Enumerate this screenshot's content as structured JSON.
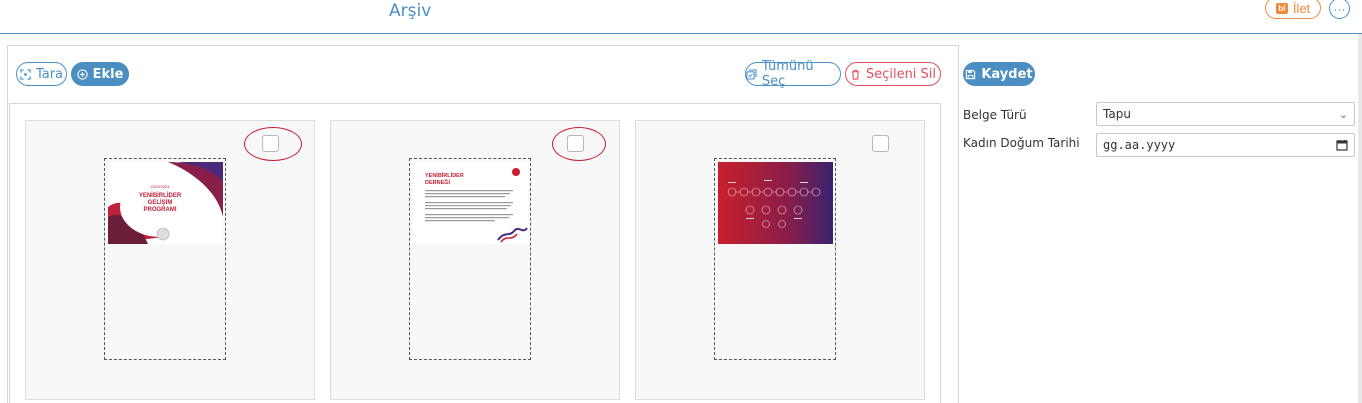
{
  "header": {
    "title": "Arşiv",
    "ilet_label": "İlet",
    "more_label": "···"
  },
  "toolbar": {
    "tara_label": "Tara",
    "ekle_label": "Ekle",
    "select_all_label": "Tümünü Seç",
    "delete_selected_label": "Seçileni Sil"
  },
  "documents": [
    {
      "id": "1",
      "checked": false,
      "highlighted": true,
      "thumb_lines": [
        "2023/2024",
        "YENİBİRLİDER",
        "GELİŞİM",
        "PROGRAMI"
      ]
    },
    {
      "id": "2",
      "checked": false,
      "highlighted": true,
      "thumb_lines": [
        "YENİBİRLİDER",
        "DERNEĞİ"
      ]
    },
    {
      "id": "3",
      "checked": false,
      "highlighted": false,
      "thumb_lines": []
    }
  ],
  "form": {
    "save_label": "Kaydet",
    "document_type_label": "Belge Türü",
    "document_type_value": "Tapu",
    "birth_date_label": "Kadın Doğum Tarihi",
    "birth_date_placeholder": "gg.aa.yyyy"
  },
  "colors": {
    "accent": "#4a90c8",
    "danger": "#e05060",
    "warning": "#f0893a",
    "highlight": "#c81e32"
  }
}
